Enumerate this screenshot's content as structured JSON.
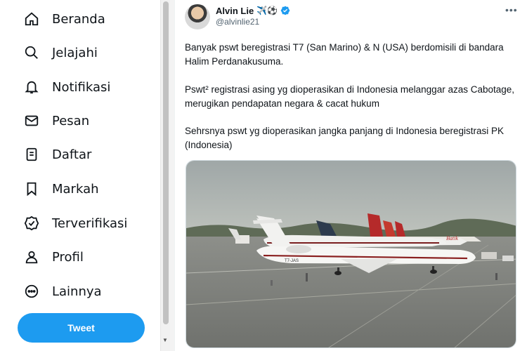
{
  "sidebar": {
    "items": [
      {
        "label": "Beranda",
        "icon": "home-icon"
      },
      {
        "label": "Jelajahi",
        "icon": "search-icon"
      },
      {
        "label": "Notifikasi",
        "icon": "bell-icon"
      },
      {
        "label": "Pesan",
        "icon": "mail-icon"
      },
      {
        "label": "Daftar",
        "icon": "list-icon"
      },
      {
        "label": "Markah",
        "icon": "bookmark-icon"
      },
      {
        "label": "Terverifikasi",
        "icon": "verified-badge-icon"
      },
      {
        "label": "Profil",
        "icon": "person-icon"
      },
      {
        "label": "Lainnya",
        "icon": "more-circle-icon"
      }
    ],
    "tweet_button": "Tweet"
  },
  "tweet": {
    "author": {
      "name": "Alvin Lie",
      "emoji": "✈️⚽",
      "handle": "@alvinlie21",
      "verified": true
    },
    "more_icon": "more-horizontal-icon",
    "paragraphs": [
      "Banyak pswt beregistrasi T7 (San Marino) & N (USA) berdomisili di bandara Halim Perdanakusuma.",
      "Pswt² registrasi asing yg dioperasikan di Indonesia melanggar azas Cabotage, merugikan pendapatan negara & cacat hukum",
      "Sehrsnya pswt yg dioperasikan jangka panjang di Indonesia beregistrasi PK (Indonesia)"
    ],
    "photo": {
      "plane_registration": "T7-JAS",
      "airline_tail_text": "Batik"
    }
  },
  "colors": {
    "accent": "#1d9bf0",
    "text": "#0f1419",
    "secondary": "#536471"
  }
}
